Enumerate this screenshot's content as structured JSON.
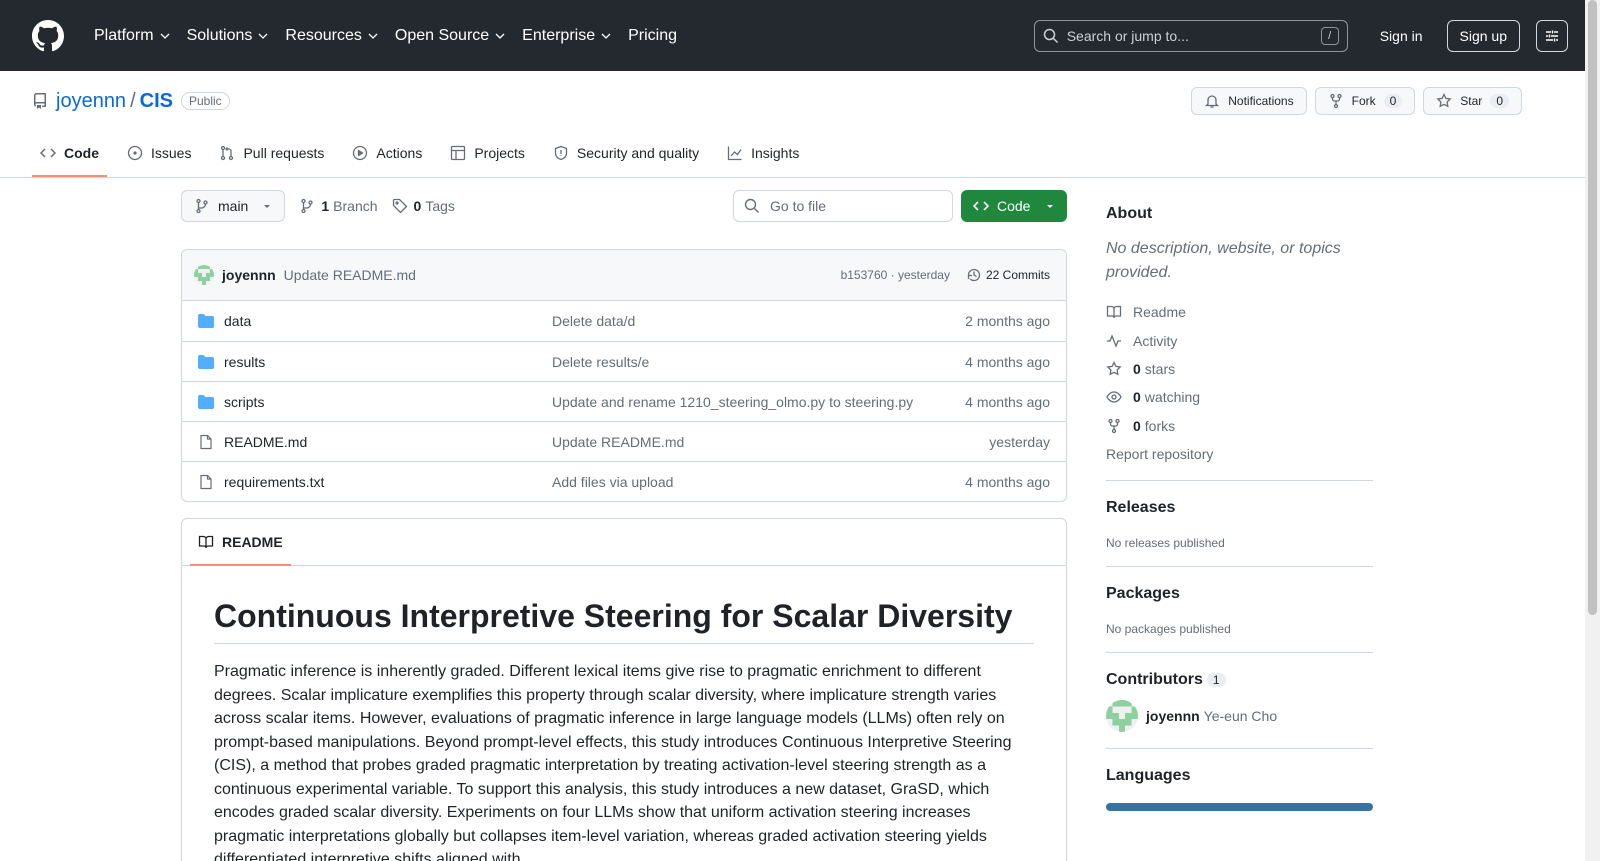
{
  "topnav": {
    "items": [
      "Platform",
      "Solutions",
      "Resources",
      "Open Source",
      "Enterprise",
      "Pricing"
    ],
    "search_placeholder": "Search or jump to...",
    "slash_key": "/",
    "sign_in": "Sign in",
    "sign_up": "Sign up"
  },
  "repo": {
    "owner": "joyennn",
    "slash": "/",
    "name": "CIS",
    "visibility": "Public",
    "notifications_label": "Notifications",
    "fork_label": "Fork",
    "fork_count": "0",
    "star_label": "Star",
    "star_count": "0"
  },
  "tabs": [
    "Code",
    "Issues",
    "Pull requests",
    "Actions",
    "Projects",
    "Security and quality",
    "Insights"
  ],
  "toolbar": {
    "branch": "main",
    "branch_count": "1",
    "branch_label": "Branch",
    "tag_count": "0",
    "tag_label": "Tags",
    "goto_placeholder": "Go to file",
    "code_label": "Code"
  },
  "commit": {
    "author": "joyennn",
    "message": "Update README.md",
    "hash_time": "b153760 · yesterday",
    "count_label": "22 Commits"
  },
  "files": [
    {
      "name": "data",
      "type": "folder",
      "message": "Delete data/d",
      "time": "2 months ago"
    },
    {
      "name": "results",
      "type": "folder",
      "message": "Delete results/e",
      "time": "4 months ago"
    },
    {
      "name": "scripts",
      "type": "folder",
      "message": "Update and rename 1210_steering_olmo.py to steering.py",
      "time": "4 months ago"
    },
    {
      "name": "README.md",
      "type": "file",
      "message": "Update README.md",
      "time": "yesterday"
    },
    {
      "name": "requirements.txt",
      "type": "file",
      "message": "Add files via upload",
      "time": "4 months ago"
    }
  ],
  "readme": {
    "tab_label": "README",
    "title": "Continuous Interpretive Steering for Scalar Diversity",
    "body": "Pragmatic inference is inherently graded. Different lexical items give rise to pragmatic enrichment to different degrees. Scalar implicature exemplifies this property through scalar diversity, where implicature strength varies across scalar items. However, evaluations of pragmatic inference in large language models (LLMs) often rely on prompt-based manipulations. Beyond prompt-level effects, this study introduces Continuous Interpretive Steering (CIS), a method that probes graded pragmatic interpretation by treating activation-level steering strength as a continuous experimental variable. To support this analysis, this study introduces a new dataset, GraSD, which encodes graded scalar diversity. Experiments on four LLMs show that uniform activation steering increases pragmatic interpretations globally but collapses item-level variation, whereas graded activation steering yields differentiated interpretive shifts aligned with"
  },
  "sidebar": {
    "about_title": "About",
    "about_desc": "No description, website, or topics provided.",
    "readme_link": "Readme",
    "activity_link": "Activity",
    "stars_count": "0",
    "stars_label": "stars",
    "watching_count": "0",
    "watching_label": "watching",
    "forks_count": "0",
    "forks_label": "forks",
    "report": "Report repository",
    "releases_title": "Releases",
    "releases_empty": "No releases published",
    "packages_title": "Packages",
    "packages_empty": "No packages published",
    "contributors_title": "Contributors",
    "contributors_count": "1",
    "contributor_login": "joyennn",
    "contributor_name": "Ye-eun Cho",
    "languages_title": "Languages"
  },
  "colors": {
    "header_bg": "#24292f",
    "link": "#0969da",
    "code_button": "#1f883d",
    "active_tab_underline": "#fd8c73",
    "language_bar": "#3572a5"
  }
}
